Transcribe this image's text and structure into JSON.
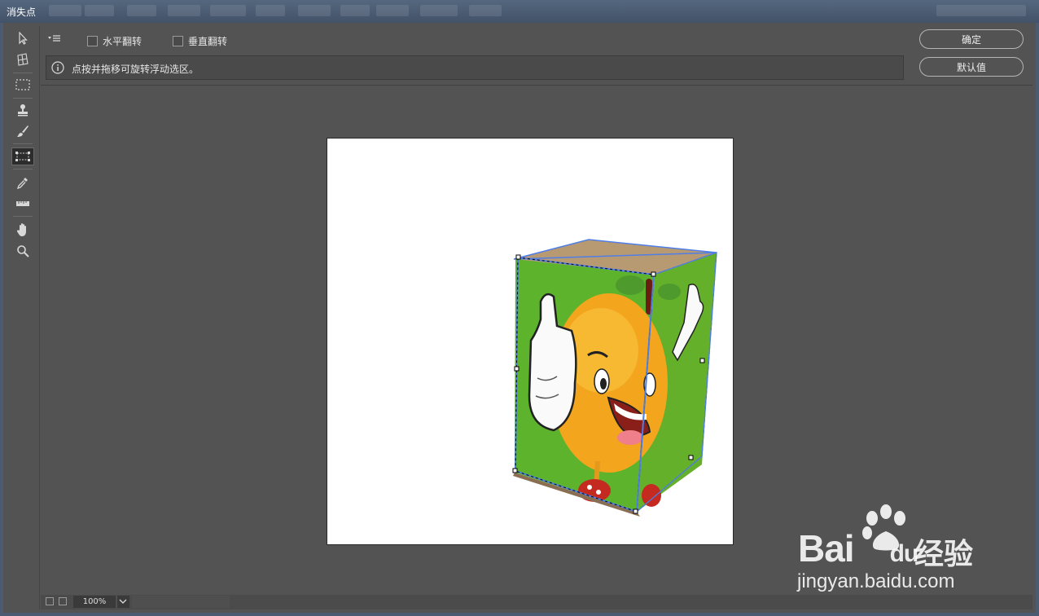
{
  "window": {
    "title": "消失点"
  },
  "options": {
    "flip_horizontal_label": "水平翻转",
    "flip_vertical_label": "垂直翻转",
    "info_message": "点按并拖移可旋转浮动选区。",
    "ok_label": "确定",
    "default_label": "默认值"
  },
  "tools": [
    {
      "name": "edit-plane-tool",
      "icon": "arrow-icon"
    },
    {
      "name": "create-plane-tool",
      "icon": "grid-plane-icon"
    },
    {
      "name": "marquee-tool",
      "icon": "marquee-icon"
    },
    {
      "name": "stamp-tool",
      "icon": "stamp-icon"
    },
    {
      "name": "brush-tool",
      "icon": "brush-icon"
    },
    {
      "name": "transform-tool",
      "icon": "transform-icon",
      "active": true
    },
    {
      "name": "eyedropper-tool",
      "icon": "eyedropper-icon"
    },
    {
      "name": "measure-tool",
      "icon": "ruler-icon"
    },
    {
      "name": "hand-tool",
      "icon": "hand-icon"
    },
    {
      "name": "zoom-tool",
      "icon": "zoom-icon"
    }
  ],
  "status": {
    "zoom": "100%"
  },
  "watermark": {
    "brand": "Bai",
    "brand_tail": "du",
    "cn": "经验",
    "url": "jingyan.baidu.com"
  },
  "colors": {
    "accent_selection": "#4f7ee6",
    "box_green": "#5db32c",
    "orange": "#f3a51d"
  }
}
